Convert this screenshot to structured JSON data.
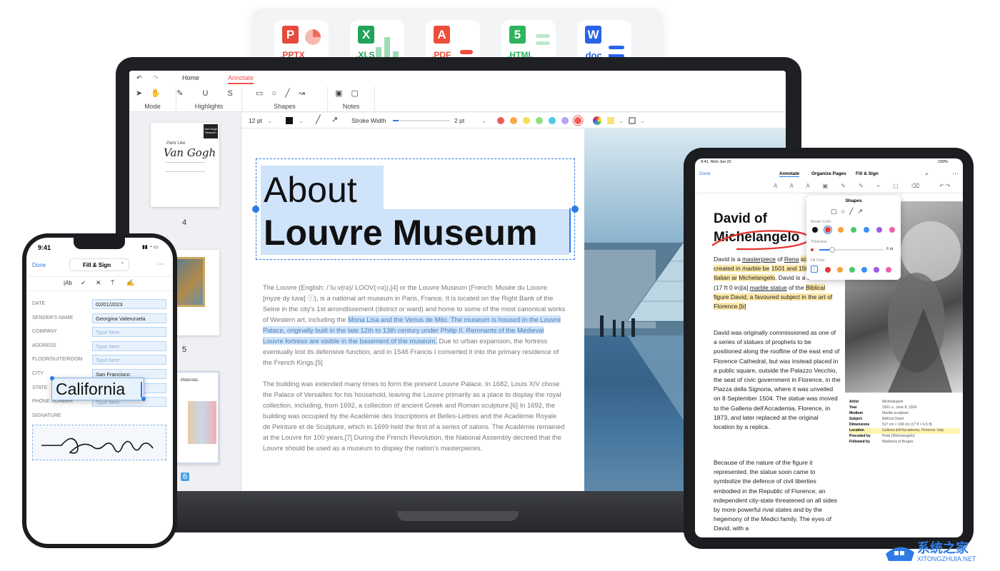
{
  "formats": [
    {
      "badge": "P",
      "ext": ".PPTX",
      "color": "#e64a3c",
      "text_color": "#e64a3c"
    },
    {
      "badge": "X",
      "ext": ".XLS",
      "color": "#22a35a",
      "text_color": "#22a35a"
    },
    {
      "badge": "A",
      "ext": ".PDF",
      "color": "#ef4d3c",
      "text_color": "#ef4d3c"
    },
    {
      "badge": "5",
      "ext": ".HTML",
      "color": "#2fb35e",
      "text_color": "#2fb35e"
    },
    {
      "badge": "W",
      "ext": ".doc",
      "color": "#2764e8",
      "text_color": "#2764e8"
    }
  ],
  "laptop": {
    "menubar": {
      "home": "Home",
      "annotate": "Annotate"
    },
    "ribbon": {
      "mode": "Mode",
      "highlights": "Highlights",
      "shapes": "Shapes",
      "notes": "Notes"
    },
    "subtoolbar": {
      "font_size": "12 pt",
      "stroke_width_label": "Stroke Width",
      "stroke_value": "2 pt"
    },
    "swatches": [
      "#f05a5a",
      "#f7a84a",
      "#f5e05a",
      "#8fe07a",
      "#4fc7e8",
      "#b79ff2",
      "#f05a5a"
    ],
    "thumb_numbers": [
      "4",
      "5",
      "6"
    ],
    "thumb_cover": {
      "small": "Paint Like",
      "title": "Van Gogh",
      "badge": "Van Gogh Museum"
    },
    "thumb_materials": "Materials",
    "document": {
      "title_line1": "About",
      "title_line2": "Louvre Museum",
      "para1_a": "The Louvre (English: /ˈluːv(rə)/ LOOV(-rə)),[4] or the Louvre Museum (French: Musée du Louvre [myze dy luvʁ] ⓘ), is a national art museum in Paris, France. It is located on the Right Bank of the Seine in the city's 1st arrondissement (district or ward) and home to some of the most canonical works of Western art, including the ",
      "para1_hl": "Mona Lisa and the Venus de Milo. The museum is housed in the Louvre Palace, originally built in the late 12th to 13th century under Philip II. Remnants of the Medieval Louvre fortress are visible in the basement of the museum.",
      "para1_b": " Due to urban expansion, the fortress eventually lost its defensive function, and in 1546 Francis I converted it into the primary residence of the French Kings.[5]",
      "para2": "The building was extended many times to form the present Louvre Palace. In 1682, Louis XIV chose the Palace of Versailles for his household, leaving the Louvre primarily as a place to display the royal collection, including, from 1692, a collection of ancient Greek and Roman sculpture.[6] In 1692, the building was occupied by the Académie des Inscriptions et Belles-Lettres and the Académie Royale de Peinture et de Sculpture, which in 1699 held the first of a series of salons. The Académie remained at the Louvre for 100 years.[7] During the French Revolution, the National Assembly decreed that the Louvre should be used as a museum to display the nation's masterpieces."
    }
  },
  "tablet": {
    "status_time": "9:41",
    "status_date": "Mon Jun 22",
    "status_battery": "100%",
    "done": "Done",
    "tabs": [
      "Annotate",
      "Organize Pages",
      "Fill & Sign"
    ],
    "shapes_popup": {
      "title": "Shapes",
      "border_color": "Border Color",
      "thickness": "Thickness",
      "thickness_value": "6 pt",
      "fill_color": "Fill Color"
    },
    "heading_line1": "David of",
    "heading_line2": "Michelangelo",
    "para1": {
      "t1": "David is a ",
      "u1": "masterpiece",
      "t2": " of ",
      "u2": "Rena",
      "hl1": "sculpture, created in marble be",
      "hl2": "1501 and 1504 by the Italian ar",
      "hl3": "Michelangelo",
      "t3": ". David is a 5.17-metre (17 ft 0 in)[a] ",
      "u3": "marble statue",
      "t4": " of the ",
      "hl4": "Biblical figure David, a favoured subject in the art of Florence.[b]"
    },
    "para2": "David was originally commissioned as one of a series of statues of prophets to be positioned along the roofline of the east end of Florence Cathedral, but was instead placed in a public square, outside the Palazzo Vecchio, the seat of civic government in Florence, in the Piazza della Signoria, where it was unveiled on 8 September 1504. The statue was moved to the Galleria dell'Accademia, Florence, in 1873, and later replaced at the original location by a replica.",
    "para3": "Because of the nature of the figure it represented, the statue soon came to symbolize the defence of civil liberties embodied in the Republic of Florence, an independent city-state threatened on all sides by more powerful rival states and by the hegemony of the Medici family. The eyes of David, with a",
    "info_keys": [
      "Artist",
      "Year",
      "Medium",
      "Subject",
      "Dimensions",
      "Location",
      "Preceded by",
      "Followed by"
    ],
    "info_values": [
      "Michelangelo",
      "1501–c. June 8, 1504",
      "Marble sculpture",
      "Biblical David",
      "517 cm × 199 cm (17 ft × 6.5 ft)",
      "Galleria dell'Accademia, Florence, Italy",
      "Pietà (Michelangelo)",
      "Madonna of Bruges"
    ],
    "border_swatches": [
      "#111111",
      "#e53935",
      "#f7a033",
      "#4cc96b",
      "#3d8ef0",
      "#9b59e6",
      "#ee5fa7"
    ],
    "fill_swatches": [
      "#e53935",
      "#f7a033",
      "#4cc96b",
      "#3d8ef0",
      "#9b59e6",
      "#ee5fa7"
    ]
  },
  "phone": {
    "time": "9:41",
    "done": "Done",
    "title": "Fill & Sign",
    "tools": [
      "|Ab",
      "✓",
      "✕"
    ],
    "fields": [
      {
        "label": "DATE",
        "value": "02/01/2023",
        "empty": false
      },
      {
        "label": "SENDER'S NAME",
        "value": "Georgina Valenzuela",
        "empty": false
      },
      {
        "label": "COMPANY",
        "value": "Type here",
        "empty": true
      },
      {
        "label": "ADDRESS",
        "value": "Type here",
        "empty": true
      },
      {
        "label": "FLOOR/SUITE/ROOM",
        "value": "Type here",
        "empty": true
      },
      {
        "label": "CITY",
        "value": "San Francisco",
        "empty": false
      },
      {
        "label": "STATE",
        "value": "",
        "empty": false
      },
      {
        "label": "PHONE NUMBER",
        "value": "Type here",
        "empty": true
      }
    ],
    "signature_label": "SIGNATURE",
    "state_overlay": "California"
  },
  "watermark": {
    "cn": "系统之家",
    "url": "XITONGZHIJIA.NET"
  }
}
